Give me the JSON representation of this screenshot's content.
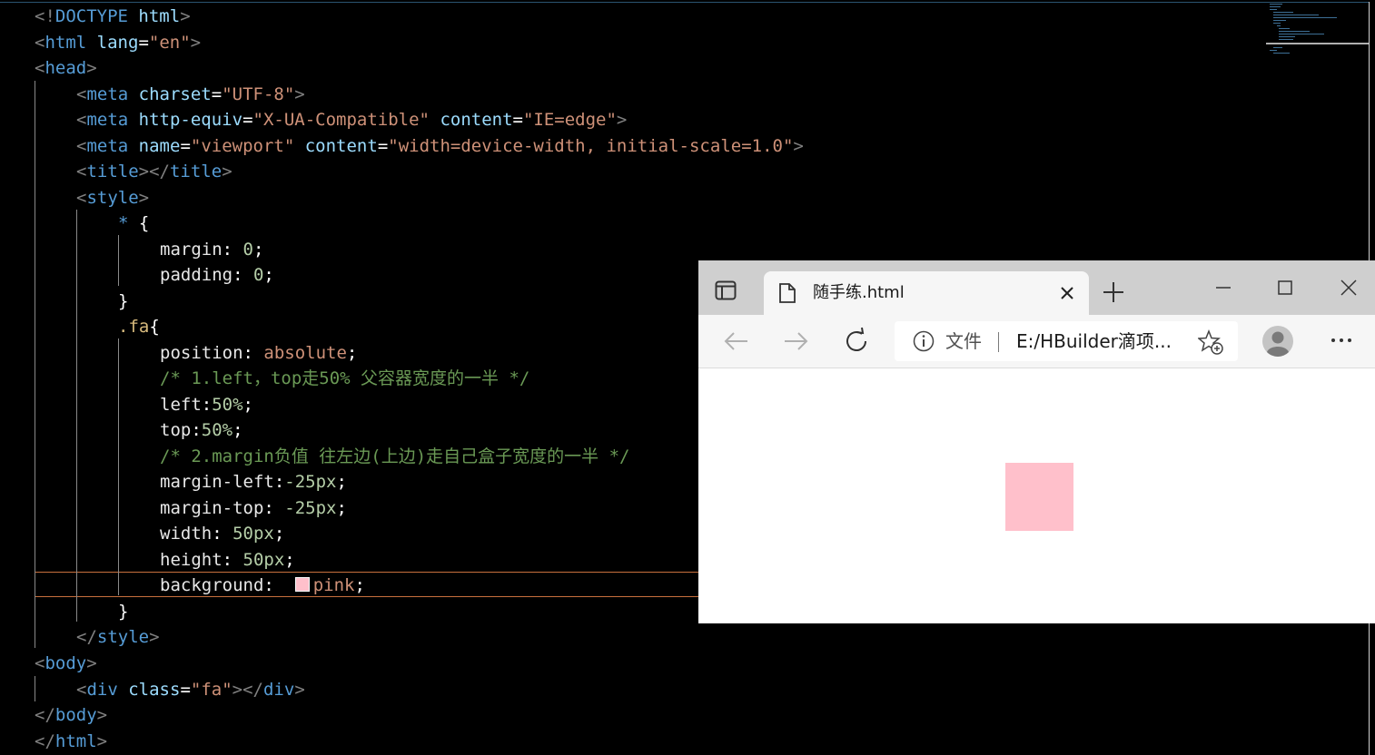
{
  "editor": {
    "lines": [
      [
        {
          "t": "<!",
          "c": "t-punc"
        },
        {
          "t": "DOCTYPE",
          "c": "t-tag"
        },
        {
          "t": " ",
          "c": ""
        },
        {
          "t": "html",
          "c": "t-attr"
        },
        {
          "t": ">",
          "c": "t-punc"
        }
      ],
      [
        {
          "t": "<",
          "c": "t-punc"
        },
        {
          "t": "html",
          "c": "t-tag"
        },
        {
          "t": " ",
          "c": ""
        },
        {
          "t": "lang",
          "c": "t-attr"
        },
        {
          "t": "=",
          "c": "t-white"
        },
        {
          "t": "\"en\"",
          "c": "t-str"
        },
        {
          "t": ">",
          "c": "t-punc"
        }
      ],
      [
        {
          "t": "<",
          "c": "t-punc"
        },
        {
          "t": "head",
          "c": "t-tag"
        },
        {
          "t": ">",
          "c": "t-punc"
        }
      ],
      [
        {
          "t": "<",
          "c": "t-punc"
        },
        {
          "t": "meta",
          "c": "t-tag"
        },
        {
          "t": " ",
          "c": ""
        },
        {
          "t": "charset",
          "c": "t-attr"
        },
        {
          "t": "=",
          "c": "t-white"
        },
        {
          "t": "\"UTF-8\"",
          "c": "t-str"
        },
        {
          "t": ">",
          "c": "t-punc"
        }
      ],
      [
        {
          "t": "<",
          "c": "t-punc"
        },
        {
          "t": "meta",
          "c": "t-tag"
        },
        {
          "t": " ",
          "c": ""
        },
        {
          "t": "http-equiv",
          "c": "t-attr"
        },
        {
          "t": "=",
          "c": "t-white"
        },
        {
          "t": "\"X-UA-Compatible\"",
          "c": "t-str"
        },
        {
          "t": " ",
          "c": ""
        },
        {
          "t": "content",
          "c": "t-attr"
        },
        {
          "t": "=",
          "c": "t-white"
        },
        {
          "t": "\"IE=edge\"",
          "c": "t-str"
        },
        {
          "t": ">",
          "c": "t-punc"
        }
      ],
      [
        {
          "t": "<",
          "c": "t-punc"
        },
        {
          "t": "meta",
          "c": "t-tag"
        },
        {
          "t": " ",
          "c": ""
        },
        {
          "t": "name",
          "c": "t-attr"
        },
        {
          "t": "=",
          "c": "t-white"
        },
        {
          "t": "\"viewport\"",
          "c": "t-str"
        },
        {
          "t": " ",
          "c": ""
        },
        {
          "t": "content",
          "c": "t-attr"
        },
        {
          "t": "=",
          "c": "t-white"
        },
        {
          "t": "\"width=device-width, initial-scale=1.0\"",
          "c": "t-str"
        },
        {
          "t": ">",
          "c": "t-punc"
        }
      ],
      [
        {
          "t": "<",
          "c": "t-punc"
        },
        {
          "t": "title",
          "c": "t-tag"
        },
        {
          "t": "></",
          "c": "t-punc"
        },
        {
          "t": "title",
          "c": "t-tag"
        },
        {
          "t": ">",
          "c": "t-punc"
        }
      ],
      [
        {
          "t": "<",
          "c": "t-punc"
        },
        {
          "t": "style",
          "c": "t-tag"
        },
        {
          "t": ">",
          "c": "t-punc"
        }
      ],
      [
        {
          "t": "* ",
          "c": "t-tag"
        },
        {
          "t": "{",
          "c": "t-white"
        }
      ],
      [
        {
          "t": "margin",
          "c": "t-bright"
        },
        {
          "t": ": ",
          "c": "t-white"
        },
        {
          "t": "0",
          "c": "t-num"
        },
        {
          "t": ";",
          "c": "t-white"
        }
      ],
      [
        {
          "t": "padding",
          "c": "t-bright"
        },
        {
          "t": ": ",
          "c": "t-white"
        },
        {
          "t": "0",
          "c": "t-num"
        },
        {
          "t": ";",
          "c": "t-white"
        }
      ],
      [
        {
          "t": "}",
          "c": "t-white"
        }
      ],
      [
        {
          "t": ".fa",
          "c": "t-sel"
        },
        {
          "t": "{",
          "c": "t-white"
        }
      ],
      [
        {
          "t": "position",
          "c": "t-bright"
        },
        {
          "t": ": ",
          "c": "t-white"
        },
        {
          "t": "absolute",
          "c": "t-kw"
        },
        {
          "t": ";",
          "c": "t-white"
        }
      ],
      [
        {
          "t": "/* 1.left，top走50% 父容器宽度的一半 */",
          "c": "t-com"
        }
      ],
      [
        {
          "t": "left",
          "c": "t-bright"
        },
        {
          "t": ":",
          "c": "t-white"
        },
        {
          "t": "50%",
          "c": "t-num"
        },
        {
          "t": ";",
          "c": "t-white"
        }
      ],
      [
        {
          "t": "top",
          "c": "t-bright"
        },
        {
          "t": ":",
          "c": "t-white"
        },
        {
          "t": "50%",
          "c": "t-num"
        },
        {
          "t": ";",
          "c": "t-white"
        }
      ],
      [
        {
          "t": "/* 2.margin负值 往左边(上边)走自己盒子宽度的一半 */",
          "c": "t-com"
        }
      ],
      [
        {
          "t": "margin-left",
          "c": "t-bright"
        },
        {
          "t": ":",
          "c": "t-white"
        },
        {
          "t": "-25px",
          "c": "t-num"
        },
        {
          "t": ";",
          "c": "t-white"
        }
      ],
      [
        {
          "t": "margin-top",
          "c": "t-bright"
        },
        {
          "t": ": ",
          "c": "t-white"
        },
        {
          "t": "-25px",
          "c": "t-num"
        },
        {
          "t": ";",
          "c": "t-white"
        }
      ],
      [
        {
          "t": "width",
          "c": "t-bright"
        },
        {
          "t": ": ",
          "c": "t-white"
        },
        {
          "t": "50px",
          "c": "t-num"
        },
        {
          "t": ";",
          "c": "t-white"
        }
      ],
      [
        {
          "t": "height",
          "c": "t-bright"
        },
        {
          "t": ": ",
          "c": "t-white"
        },
        {
          "t": "50px",
          "c": "t-num"
        },
        {
          "t": ";",
          "c": "t-white"
        }
      ],
      [
        {
          "t": "background",
          "c": "t-bright"
        },
        {
          "t": ":  ",
          "c": "t-white"
        },
        {
          "t": "#swatch",
          "c": "swatch"
        },
        {
          "t": "pink",
          "c": "t-kw"
        },
        {
          "t": ";",
          "c": "t-white"
        }
      ],
      [
        {
          "t": "}",
          "c": "t-white"
        }
      ],
      [
        {
          "t": "</",
          "c": "t-punc"
        },
        {
          "t": "style",
          "c": "t-tag"
        },
        {
          "t": ">",
          "c": "t-punc"
        }
      ],
      [
        {
          "t": "<",
          "c": "t-punc"
        },
        {
          "t": "body",
          "c": "t-tag"
        },
        {
          "t": ">",
          "c": "t-punc"
        }
      ],
      [
        {
          "t": "<",
          "c": "t-punc"
        },
        {
          "t": "div",
          "c": "t-tag"
        },
        {
          "t": " ",
          "c": ""
        },
        {
          "t": "class",
          "c": "t-attr"
        },
        {
          "t": "=",
          "c": "t-white"
        },
        {
          "t": "\"fa\"",
          "c": "t-str"
        },
        {
          "t": "></",
          "c": "t-punc"
        },
        {
          "t": "div",
          "c": "t-tag"
        },
        {
          "t": ">",
          "c": "t-punc"
        }
      ],
      [
        {
          "t": "</",
          "c": "t-punc"
        },
        {
          "t": "body",
          "c": "t-tag"
        },
        {
          "t": ">",
          "c": "t-punc"
        }
      ],
      [
        {
          "t": "</",
          "c": "t-punc"
        },
        {
          "t": "html",
          "c": "t-tag"
        },
        {
          "t": ">",
          "c": "t-punc"
        }
      ]
    ],
    "indent_levels": [
      0,
      0,
      0,
      1,
      1,
      1,
      1,
      1,
      2,
      3,
      3,
      2,
      2,
      3,
      3,
      3,
      3,
      3,
      3,
      3,
      3,
      3,
      3,
      2,
      1,
      0,
      1,
      0,
      0
    ],
    "active_line": 23
  },
  "browser": {
    "tab_title": "随手练.html",
    "address_scheme": "文件",
    "address_url": "E:/HBuilder滴项...",
    "content": {
      "box_color": "#ffc0cb"
    }
  },
  "colors": {
    "editor_bg": "#000000",
    "tab_strip": "#cfcfcf",
    "toolbar": "#f6f6f6"
  },
  "icons": {
    "tab_actions": "tab-actions-icon",
    "page": "page-icon",
    "close_tab": "close-icon",
    "new_tab": "plus-icon",
    "minimize": "minimize-icon",
    "maximize": "maximize-icon",
    "close_window": "close-window-icon",
    "back": "back-arrow-icon",
    "forward": "forward-arrow-icon",
    "refresh": "refresh-icon",
    "info": "info-icon",
    "favorite": "favorite-add-icon",
    "profile": "profile-avatar",
    "more": "more-icon"
  }
}
